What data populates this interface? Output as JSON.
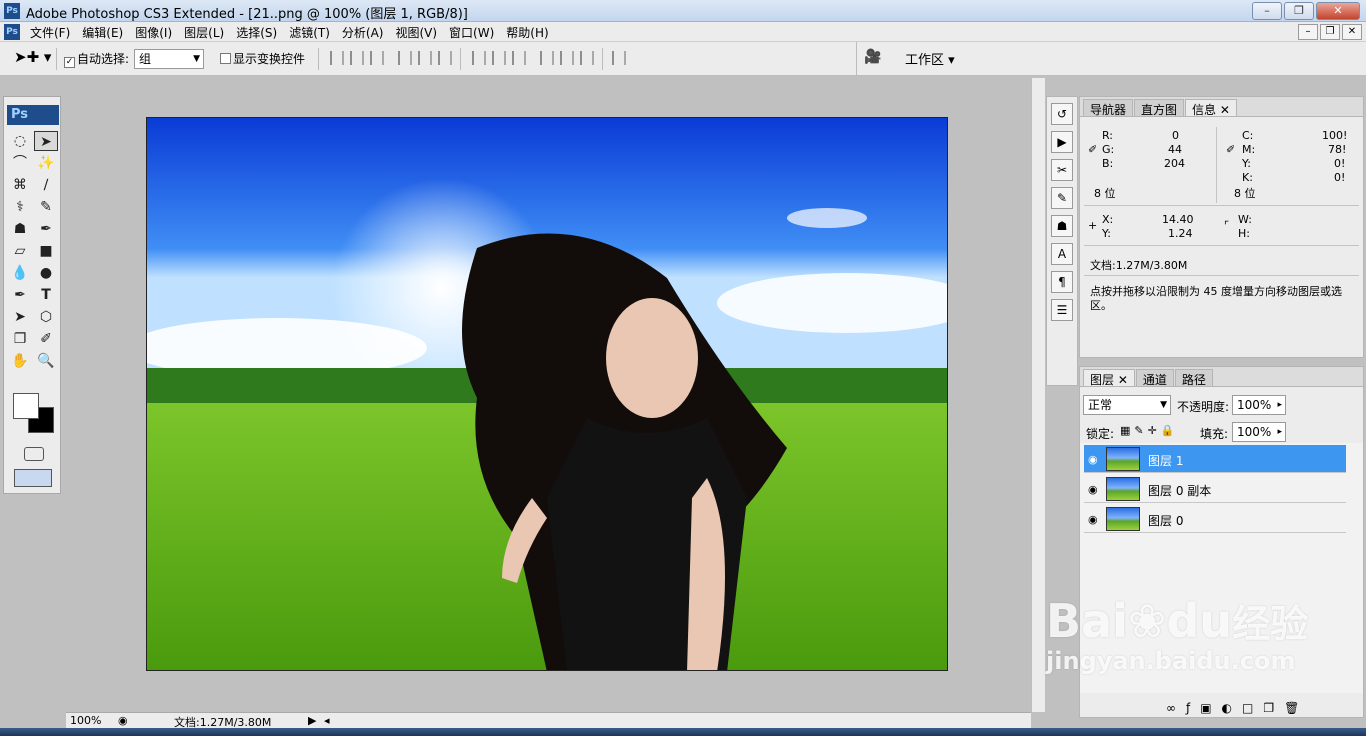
{
  "window": {
    "title": "Adobe Photoshop CS3 Extended - [21..png @ 100% (图层 1, RGB/8)]",
    "ps_logo": "Ps"
  },
  "menu": {
    "items": [
      "文件(F)",
      "编辑(E)",
      "图像(I)",
      "图层(L)",
      "选择(S)",
      "滤镜(T)",
      "分析(A)",
      "视图(V)",
      "窗口(W)",
      "帮助(H)"
    ]
  },
  "options": {
    "auto_select_label": "自动选择:",
    "auto_select_value": "组",
    "show_transform_label": "显示变换控件",
    "workspace_label": "工作区"
  },
  "tools": {
    "logo": "Ps"
  },
  "status": {
    "zoom": "100%",
    "doc_size": "文档:1.27M/3.80M"
  },
  "info_panel": {
    "tabs": [
      "导航器",
      "直方图",
      "信息"
    ],
    "r_label": "R:",
    "r_value": "0",
    "g_label": "G:",
    "g_value": "44",
    "b_label": "B:",
    "b_value": "204",
    "c_label": "C:",
    "c_value": "100!",
    "m_label": "M:",
    "m_value": "78!",
    "y_label": "Y:",
    "y_value": "0!",
    "k_label": "K:",
    "k_value": "0!",
    "bits_left": "8 位",
    "bits_right": "8 位",
    "x_label": "X:",
    "x_value": "14.40",
    "y2_label": "Y:",
    "y2_value": "1.24",
    "w_label": "W:",
    "h_label": "H:",
    "doc": "文档:1.27M/3.80M",
    "hint": "点按并拖移以沿限制为 45 度增量方向移动图层或选区。"
  },
  "layers_panel": {
    "tabs": [
      "图层",
      "通道",
      "路径"
    ],
    "blend_mode": "正常",
    "opacity_label": "不透明度:",
    "opacity_value": "100%",
    "lock_label": "锁定:",
    "fill_label": "填充:",
    "fill_value": "100%",
    "layers": [
      {
        "name": "图层 1",
        "selected": true
      },
      {
        "name": "图层 0 副本",
        "selected": false
      },
      {
        "name": "图层 0",
        "selected": false
      }
    ]
  },
  "watermark": {
    "brand": "Bai",
    "brand2": "du",
    "brand3": "经验",
    "url": "jingyan.baidu.com"
  },
  "colors": {
    "selection": "#3d96f0",
    "ps_blue": "#1f4d8c"
  }
}
